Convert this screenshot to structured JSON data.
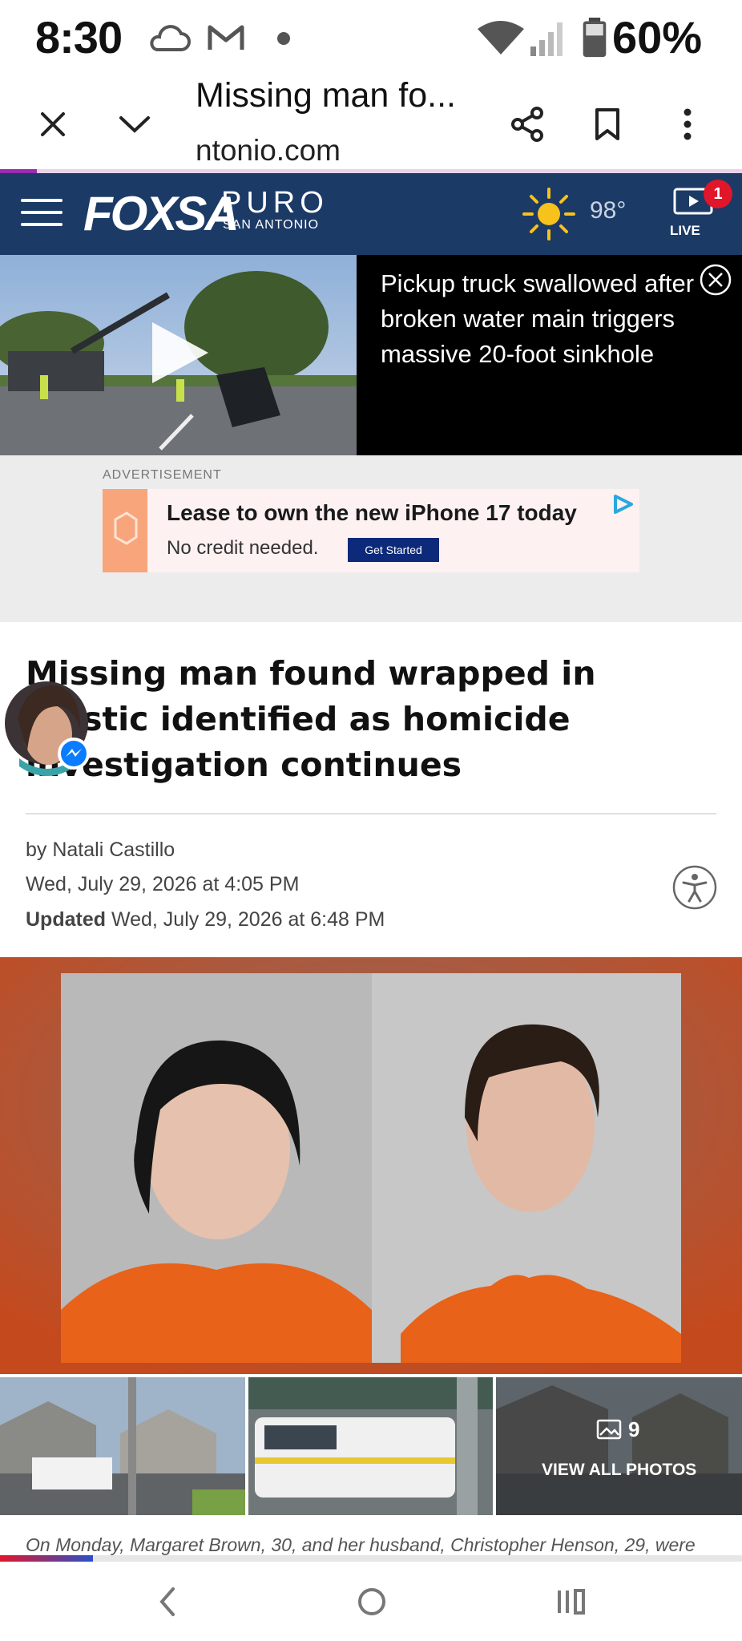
{
  "status_bar": {
    "time": "8:30",
    "battery": "60%",
    "icons": [
      "cloud-icon",
      "gmail-icon",
      "dot-icon",
      "wifi-icon",
      "signal-icon",
      "battery-icon"
    ]
  },
  "browser": {
    "page_title": "Missing man fo...",
    "url": "ntonio.com",
    "icons": [
      "close-icon",
      "chevron-down-icon",
      "share-icon",
      "bookmark-icon",
      "more-vert-icon"
    ],
    "progress_fraction": 0.05
  },
  "site_header": {
    "logo_main": "FOXSA",
    "logo_puro": "PURO",
    "logo_city": "SAN ANTONIO",
    "temperature": "98°",
    "live_label": "LIVE",
    "live_badge": "1",
    "accent": "#1c3a66"
  },
  "teaser": {
    "headline": "Pickup truck swallowed after broken water main triggers massive 20-foot sinkhole"
  },
  "ad": {
    "label": "ADVERTISEMENT",
    "headline": "Lease to own the new iPhone 17 today",
    "subtext": "No credit needed.",
    "cta": "Get Started"
  },
  "article": {
    "headline": "Missing man found wrapped in plastic identified as homicide investigation continues",
    "byline": "by Natali Castillo",
    "date": "Wed, July 29, 2026 at 4:05 PM",
    "updated_label": "Updated",
    "updated_date": "Wed, July 29, 2026 at 6:48 PM",
    "photo_count": "9",
    "view_all": "VIEW ALL PHOTOS",
    "caption": "On Monday, Margaret Brown, 30, and her husband, Christopher Henson, 29, were"
  },
  "nav": {
    "icons": [
      "back-icon",
      "home-icon",
      "recents-icon"
    ]
  }
}
